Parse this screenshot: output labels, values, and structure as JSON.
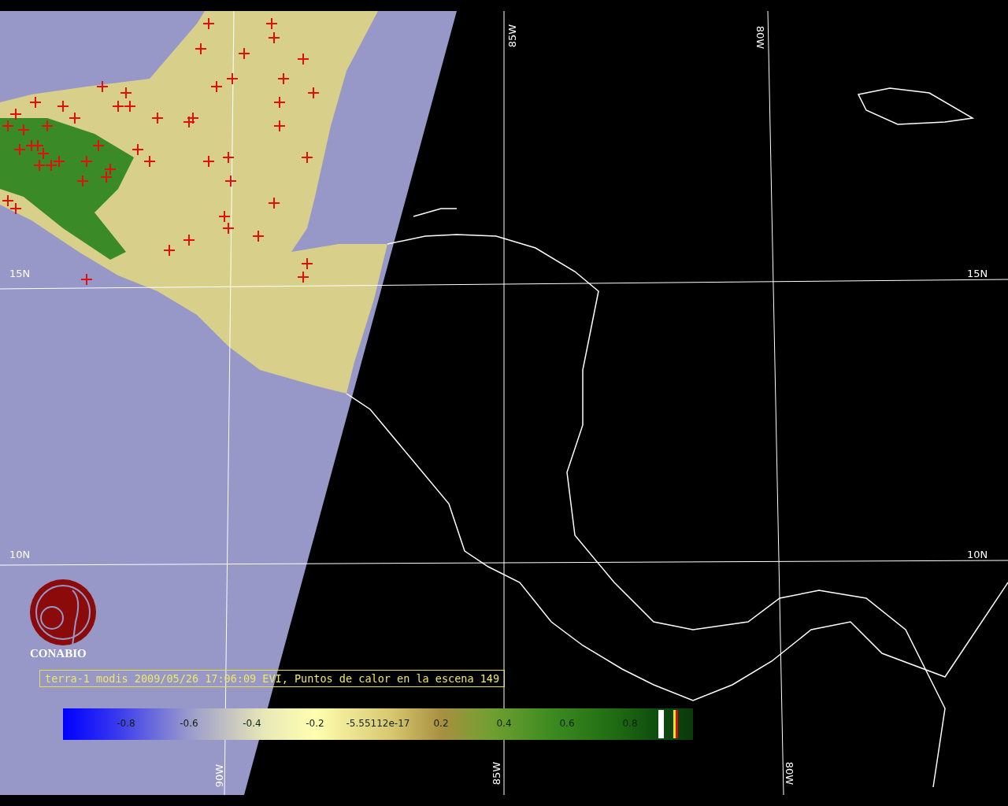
{
  "logo": {
    "name": "CONABIO"
  },
  "caption": "terra-1 modis 2009/05/26 17:06:09 EVI, Puntos de calor en la escena 149",
  "grid_labels": [
    "15N",
    "15N",
    "10N",
    "10N",
    "85W",
    "80W",
    "90W",
    "85W",
    "80W"
  ],
  "colorbar": {
    "ticks": [
      "-0.8",
      "-0.6",
      "-0.4",
      "-0.2",
      "-5.55112e-17",
      "0.2",
      "0.4",
      "0.6",
      "0.8"
    ]
  }
}
